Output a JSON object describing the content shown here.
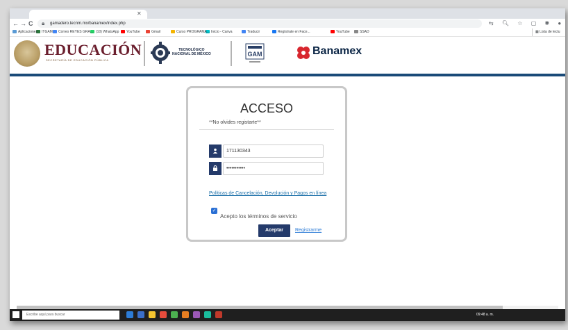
{
  "browser": {
    "url": "gamadero.tecnm.mx/banamex/index.php",
    "nav": {
      "back": "←",
      "forward": "→",
      "reload": "C"
    },
    "bookmarks": [
      {
        "label": "Aplicaciones",
        "color": "#5b9bd5"
      },
      {
        "label": "ITGAM",
        "color": "#2b7a3d"
      },
      {
        "label": "Correo REYES GRA...",
        "color": "#4285f4"
      },
      {
        "label": "(10) WhatsApp",
        "color": "#25d366"
      },
      {
        "label": "YouTube",
        "color": "#ff0000"
      },
      {
        "label": "Gmail",
        "color": "#ea4335"
      },
      {
        "label": "Curso PROGRAMA...",
        "color": "#f4b400"
      },
      {
        "label": "Inicio - Canva",
        "color": "#00c4cc"
      },
      {
        "label": "Traducir",
        "color": "#4285f4"
      },
      {
        "label": "Regístrate en Face...",
        "color": "#1877f2"
      },
      {
        "label": "YouTube",
        "color": "#ff0000"
      },
      {
        "label": "SSAD",
        "color": "#888888"
      }
    ],
    "reading_list": "Lista de lectu"
  },
  "header": {
    "edu_title": "EDUCACIÓN",
    "edu_subtitle": "SECRETARÍA DE EDUCACIÓN PÚBLICA",
    "tecnm_line1": "TECNOLÓGICO",
    "tecnm_line2": "NACIONAL DE MÉXICO",
    "gam_label": "GAM",
    "bank_name": "Banamex",
    "accent": "#1a4a78"
  },
  "login": {
    "title": "ACCESO",
    "hint": "**No olvides registarte**",
    "username": "171130343",
    "password": "•••••••••••",
    "policy_link": "Políticas de Cancelación, Devolución y Pagos en línea",
    "terms_label": "Acepto los términos de servicio",
    "terms_checked": true,
    "submit_label": "Aceptar",
    "register_label": "Registrarme",
    "button_color": "#243a6a"
  },
  "taskbar": {
    "search_placeholder": "Escribe aquí para buscar",
    "clock": "09:48 a. m."
  }
}
